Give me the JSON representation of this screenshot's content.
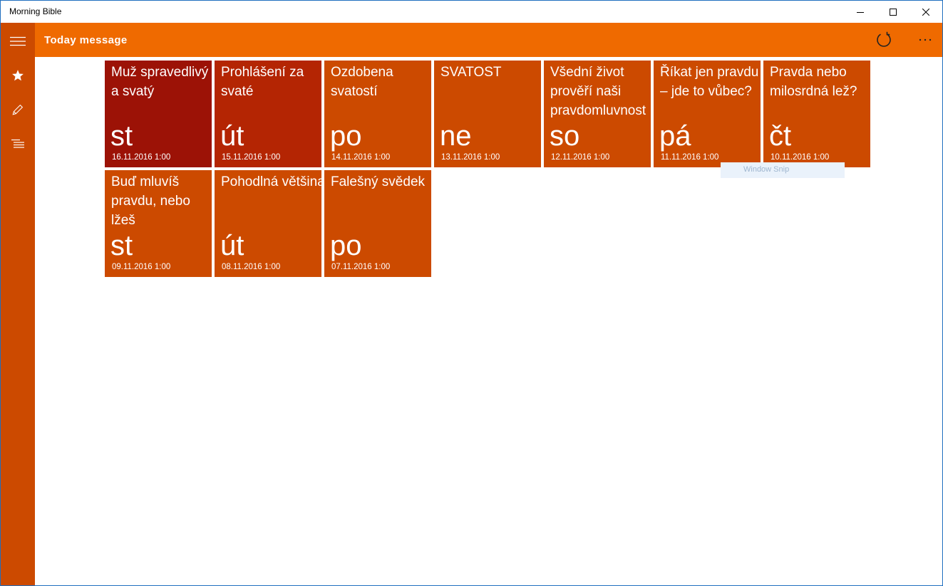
{
  "window": {
    "title": "Morning Bible"
  },
  "header": {
    "title": "Today message"
  },
  "colors": {
    "accent": "#ef6a00",
    "sidebar": "#cc4a00"
  },
  "sidebar": {
    "items": [
      {
        "icon": "hamburger-menu-icon"
      },
      {
        "icon": "star-icon"
      },
      {
        "icon": "pencil-icon"
      },
      {
        "icon": "list-icon"
      }
    ]
  },
  "toolbar": {
    "refresh_icon": "refresh-icon",
    "more_icon": "more-icon"
  },
  "tiles": [
    {
      "title": "Muž spravedlivý a svatý",
      "day": "st",
      "date": "16.11.2016 1:00",
      "color": "#9c1206"
    },
    {
      "title": "Prohlášení za svaté",
      "day": "út",
      "date": "15.11.2016 1:00",
      "color": "#b42503"
    },
    {
      "title": "Ozdobena svatostí",
      "day": "po",
      "date": "14.11.2016 1:00",
      "color": "#cc4a00"
    },
    {
      "title": "SVATOST",
      "day": "ne",
      "date": "13.11.2016 1:00",
      "color": "#cc4a00"
    },
    {
      "title": "Všední život prověří naši pravdomluvnost",
      "day": "so",
      "date": "12.11.2016 1:00",
      "color": "#cc4a00"
    },
    {
      "title": "Říkat jen pravdu – jde to vůbec?",
      "day": "pá",
      "date": "11.11.2016 1:00",
      "color": "#cc4a00"
    },
    {
      "title": "Pravda nebo milosrdná lež?",
      "day": "čt",
      "date": "10.11.2016 1:00",
      "color": "#cc4a00"
    },
    {
      "title": "Buď mluvíš pravdu, nebo lžeš",
      "day": "st",
      "date": "09.11.2016 1:00",
      "color": "#cc4a00"
    },
    {
      "title": "Pohodlná většina",
      "day": "út",
      "date": "08.11.2016 1:00",
      "color": "#cc4a00"
    },
    {
      "title": "Falešný svědek",
      "day": "po",
      "date": "07.11.2016 1:00",
      "color": "#cc4a00"
    }
  ],
  "overlay": {
    "text": "Window Snip"
  }
}
